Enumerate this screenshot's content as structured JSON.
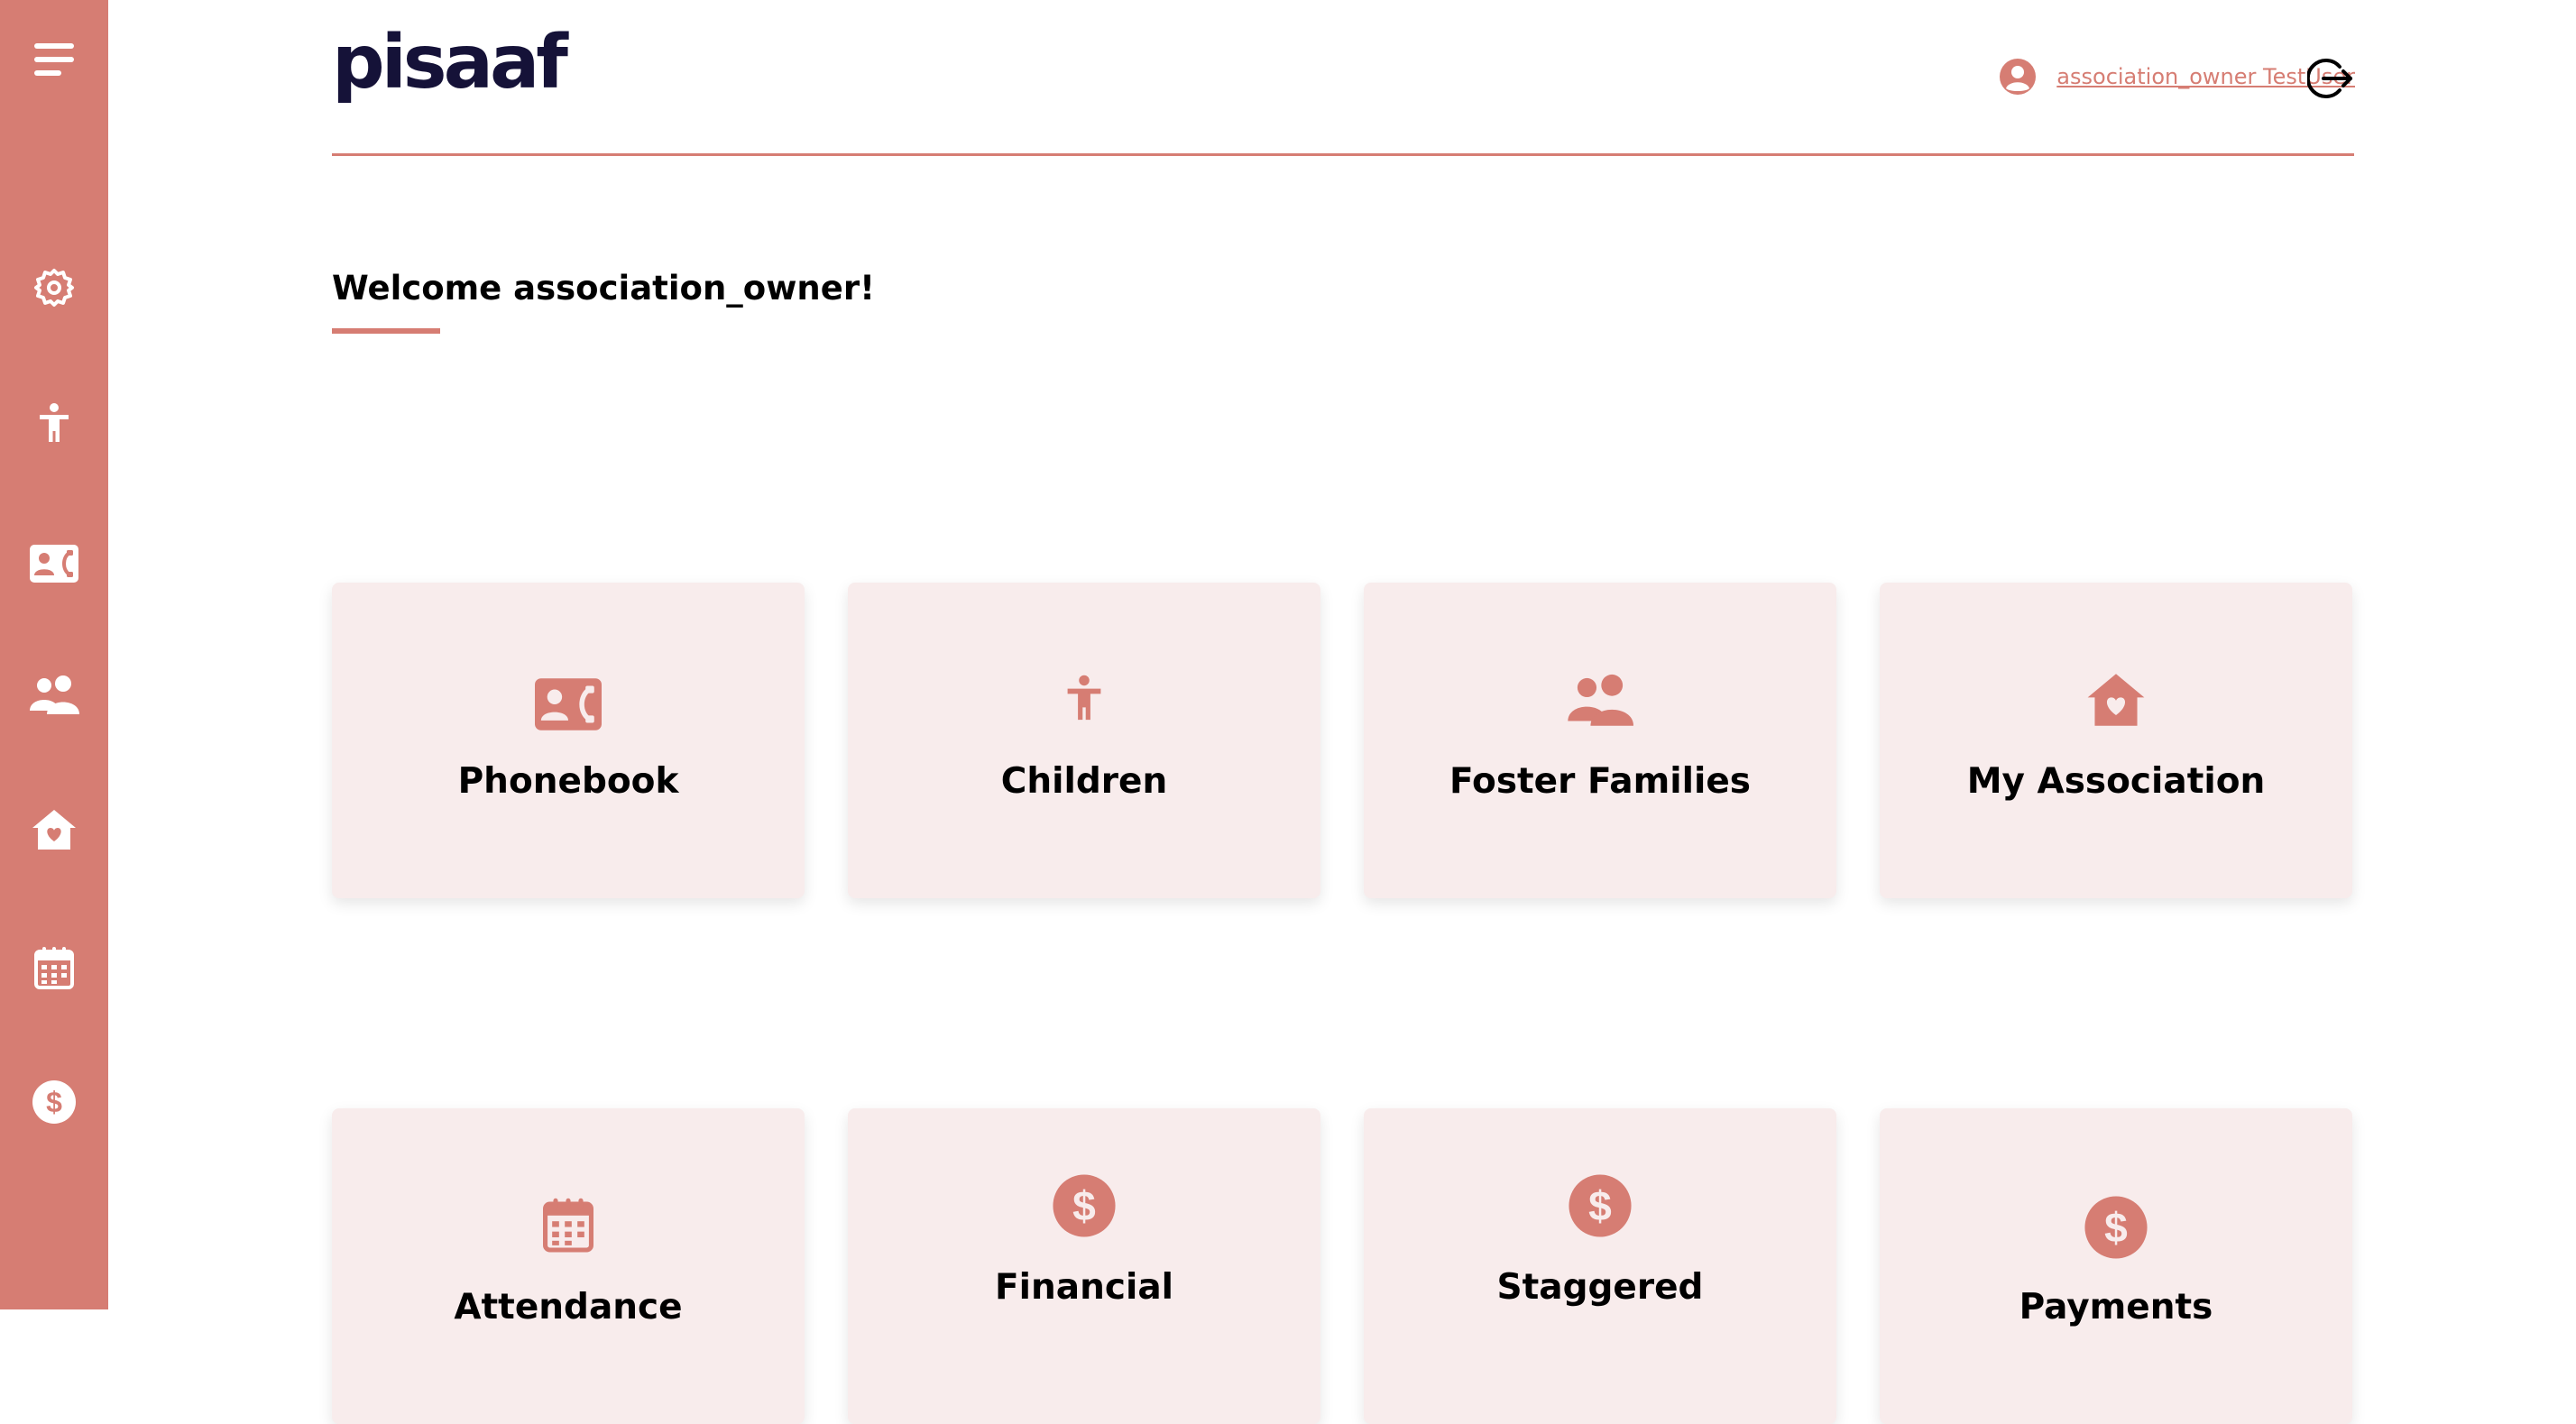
{
  "app": {
    "logo": "pisaaf"
  },
  "colors": {
    "accent": "#d67d73",
    "card_bg": "#f8ecec",
    "logo": "#151238"
  },
  "sidebar": {
    "items": [
      {
        "icon": "hamburger-menu-icon"
      },
      {
        "icon": "gear-icon"
      },
      {
        "icon": "child-icon"
      },
      {
        "icon": "contact-card-icon"
      },
      {
        "icon": "users-icon"
      },
      {
        "icon": "house-heart-icon"
      },
      {
        "icon": "calendar-icon"
      },
      {
        "icon": "dollar-circle-icon"
      }
    ]
  },
  "header": {
    "user_icon": "user-circle-icon",
    "user_name": "association_owner TestUser",
    "logout_icon": "logout-icon"
  },
  "welcome": {
    "text": "Welcome association_owner!"
  },
  "cards": [
    {
      "label": "Phonebook",
      "icon": "contact-card-icon"
    },
    {
      "label": "Children",
      "icon": "child-icon"
    },
    {
      "label": "Foster Families",
      "icon": "users-icon"
    },
    {
      "label": "My Association",
      "icon": "house-heart-icon"
    },
    {
      "label": "Attendance",
      "icon": "calendar-icon"
    },
    {
      "label": "Financial",
      "icon": "dollar-circle-icon"
    },
    {
      "label": "Staggered",
      "icon": "dollar-circle-icon"
    },
    {
      "label": "Payments",
      "icon": "dollar-circle-icon"
    }
  ]
}
